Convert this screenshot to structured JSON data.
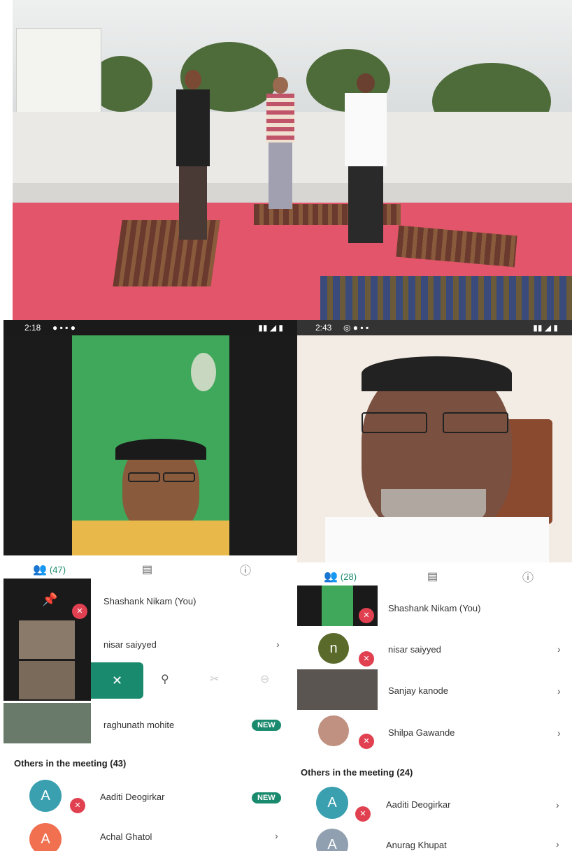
{
  "left_screen": {
    "status_time": "2:18",
    "participants_count": "(47)",
    "participants": [
      {
        "name": "Shashank Nikam (You)"
      },
      {
        "name": "nisar saiyyed"
      },
      {
        "name": "raghunath mohite",
        "badge": "NEW"
      }
    ],
    "others_title": "Others in the meeting (43)",
    "others": [
      {
        "initial": "A",
        "name": "Aaditi Deogirkar",
        "badge": "NEW"
      },
      {
        "initial": "A",
        "name": "Achal Ghatol"
      }
    ],
    "swipe_actions": {
      "close": "✕"
    }
  },
  "right_screen": {
    "status_time": "2:43",
    "participants_count": "(28)",
    "participants": [
      {
        "name": "Shashank Nikam (You)"
      },
      {
        "initial": "n",
        "name": "nisar saiyyed"
      },
      {
        "name": "Sanjay kanode"
      },
      {
        "name": "Shilpa Gawande"
      }
    ],
    "others_title": "Others in the meeting (24)",
    "others": [
      {
        "initial": "A",
        "name": "Aaditi Deogirkar"
      },
      {
        "initial": "A",
        "name": "Anurag Khupat"
      }
    ]
  },
  "colors": {
    "accent": "#1a8a6e",
    "mic_off": "#e04050",
    "avatar_teal": "#3aa0b0",
    "avatar_olive": "#5a6a2a"
  },
  "icons": [
    "people-icon",
    "chat-icon",
    "info-icon",
    "mic-off-icon",
    "pin-icon",
    "chevron-right-icon"
  ]
}
